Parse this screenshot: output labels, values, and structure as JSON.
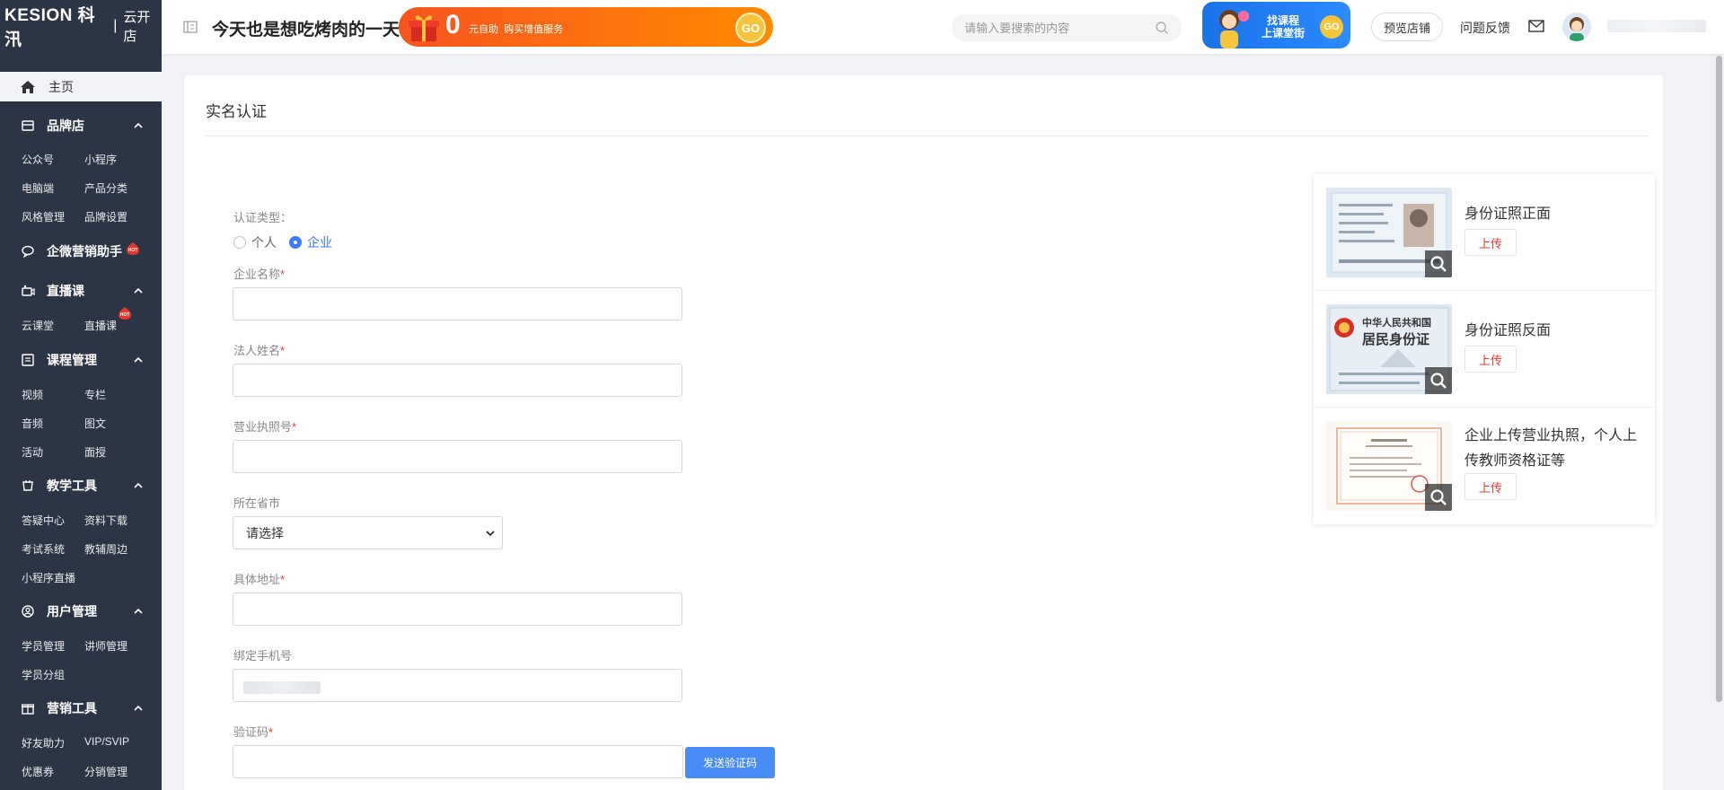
{
  "brand": {
    "logo_text": "KESION 科汛",
    "separator": "|",
    "sub": "云开店"
  },
  "topbar": {
    "slogan": "今天也是想吃烤肉的一天",
    "promo": {
      "zero": "0",
      "unit": "元自助",
      "text": "购买增值服务",
      "go": "GO",
      "color": "#f6541f"
    },
    "search_placeholder": "请输入要搜索的内容",
    "course_banner": {
      "line1": "找课程",
      "line2": "上课堂街",
      "go": "GO",
      "color": "#1a73e8"
    },
    "preview_store": "预览店铺",
    "feedback": "问题反馈"
  },
  "sidebar": {
    "home": "主页",
    "sections": [
      {
        "label": "品牌店",
        "icon": "store-icon",
        "items": [
          "公众号",
          "小程序",
          "电脑端",
          "产品分类",
          "风格管理",
          "品牌设置"
        ]
      },
      {
        "label": "企微营销助手",
        "icon": "chat-icon",
        "badge": "HOT",
        "items": []
      },
      {
        "label": "直播课",
        "icon": "live-icon",
        "items": [
          "云课堂",
          "直播课"
        ],
        "item_badge": "HOT"
      },
      {
        "label": "课程管理",
        "icon": "course-icon",
        "items": [
          "视频",
          "专栏",
          "音频",
          "图文",
          "活动",
          "面授"
        ]
      },
      {
        "label": "教学工具",
        "icon": "tools-icon",
        "items": [
          "答疑中心",
          "资料下载",
          "考试系统",
          "教辅周边",
          "小程序直播"
        ]
      },
      {
        "label": "用户管理",
        "icon": "user-icon",
        "items": [
          "学员管理",
          "讲师管理",
          "学员分组"
        ]
      },
      {
        "label": "营销工具",
        "icon": "gift-icon",
        "items": [
          "好友助力",
          "VIP/SVIP",
          "优惠券",
          "分销管理"
        ]
      }
    ]
  },
  "main": {
    "title": "实名认证",
    "form": {
      "type_label": "认证类型：",
      "options": [
        "个人",
        "企业"
      ],
      "selected": "企业",
      "company_name": "企业名称",
      "legal_person": "法人姓名",
      "license_no": "营业执照号",
      "province_city": "所在省市",
      "province_select": "请选择",
      "address": "具体地址",
      "phone": "绑定手机号",
      "code": "验证码",
      "send_code": "发送验证码",
      "required_mark": "*"
    },
    "uploads": [
      {
        "title": "身份证照正面",
        "button": "上传"
      },
      {
        "title": "身份证照反面",
        "button": "上传"
      },
      {
        "title": "企业上传营业执照，个人上传教师资格证等",
        "button": "上传"
      }
    ],
    "id_back_text": {
      "line1": "中华人民共和国",
      "line2": "居民身份证"
    }
  },
  "colors": {
    "sidebar_bg": "#2c3545",
    "accent_blue": "#3a7afe",
    "required_red": "#e53935",
    "send_button": "#4a8cf5"
  }
}
